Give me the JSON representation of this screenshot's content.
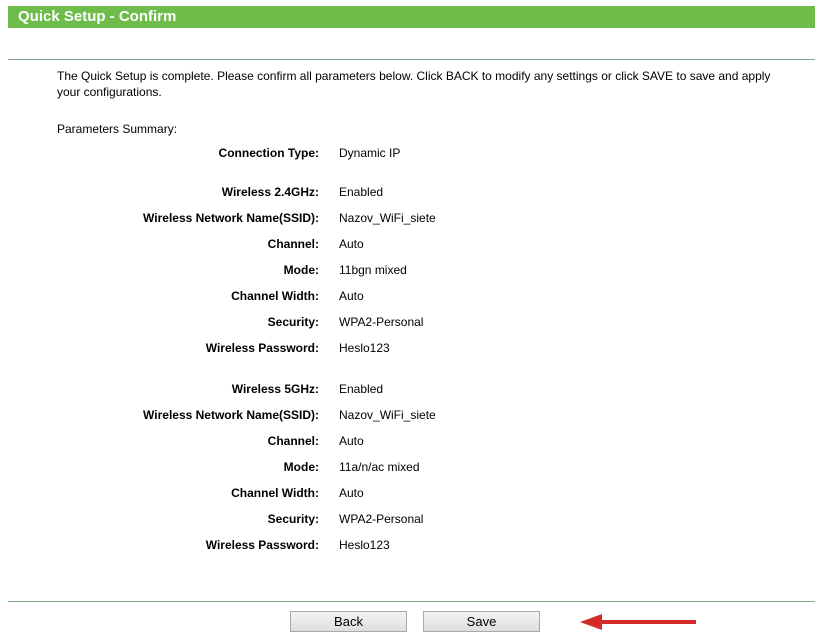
{
  "header": {
    "title": "Quick Setup - Confirm"
  },
  "intro_text": "The Quick Setup is complete. Please confirm all parameters below. Click BACK to modify any settings or click SAVE to save and apply your configurations.",
  "summary_label": "Parameters Summary:",
  "params": [
    {
      "label": "Connection Type:",
      "value": "Dynamic IP"
    },
    {
      "label": "Wireless 2.4GHz:",
      "value": "Enabled"
    },
    {
      "label": "Wireless Network Name(SSID):",
      "value": "Nazov_WiFi_siete"
    },
    {
      "label": "Channel:",
      "value": "Auto"
    },
    {
      "label": "Mode:",
      "value": "11bgn mixed"
    },
    {
      "label": "Channel Width:",
      "value": "Auto"
    },
    {
      "label": "Security:",
      "value": "WPA2-Personal"
    },
    {
      "label": "Wireless Password:",
      "value": "Heslo123"
    },
    {
      "label": "Wireless 5GHz:",
      "value": "Enabled"
    },
    {
      "label": "Wireless Network Name(SSID):",
      "value": "Nazov_WiFi_siete"
    },
    {
      "label": "Channel:",
      "value": "Auto"
    },
    {
      "label": "Mode:",
      "value": "11a/n/ac mixed"
    },
    {
      "label": "Channel Width:",
      "value": "Auto"
    },
    {
      "label": "Security:",
      "value": "WPA2-Personal"
    },
    {
      "label": "Wireless Password:",
      "value": "Heslo123"
    }
  ],
  "buttons": {
    "back_label": "Back",
    "save_label": "Save"
  },
  "colors": {
    "header_bg": "#6ebc4a",
    "header_text": "#ffffff",
    "divider": "#7aa885",
    "arrow": "#d42a2a"
  },
  "annotation": {
    "icon": "left-arrow-icon"
  }
}
